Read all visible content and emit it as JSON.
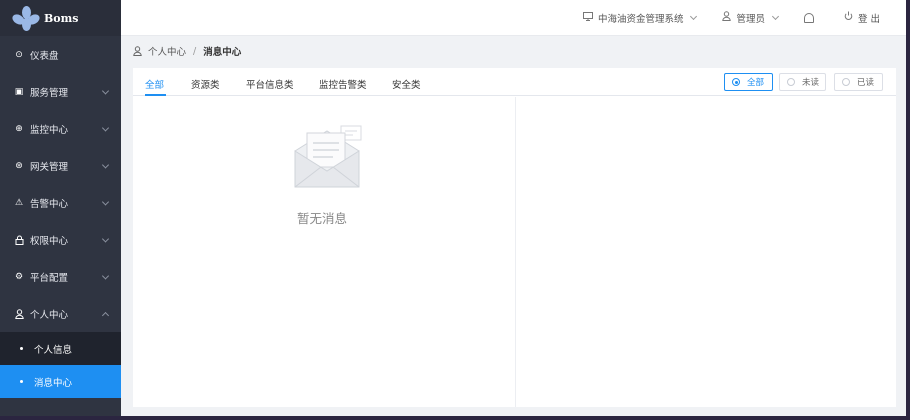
{
  "app": {
    "logo_text": "Boms"
  },
  "sidebar": {
    "items": [
      {
        "label": "仪表盘",
        "icon": "dashboard-icon",
        "glyph": "⊙",
        "has_chevron": false
      },
      {
        "label": "服务管理",
        "icon": "service-icon",
        "glyph": "▣",
        "has_chevron": true
      },
      {
        "label": "监控中心",
        "icon": "globe-icon",
        "glyph": "⊕",
        "has_chevron": true
      },
      {
        "label": "网关管理",
        "icon": "gateway-icon",
        "glyph": "⊛",
        "has_chevron": true
      },
      {
        "label": "告警中心",
        "icon": "warning-icon",
        "glyph": "⚠",
        "has_chevron": true
      },
      {
        "label": "权限中心",
        "icon": "lock-icon",
        "glyph": "🔒",
        "has_chevron": true
      },
      {
        "label": "平台配置",
        "icon": "settings-icon",
        "glyph": "⚙",
        "has_chevron": true
      },
      {
        "label": "个人中心",
        "icon": "user-icon",
        "glyph": "♙",
        "has_chevron": true,
        "expanded": true
      }
    ],
    "sub_items": [
      {
        "label": "个人信息",
        "active": false
      },
      {
        "label": "消息中心",
        "active": true
      }
    ]
  },
  "header": {
    "system_name": "中海油资金管理系统",
    "user_name": "管理员",
    "logout_label": "登 出"
  },
  "breadcrumb": {
    "parent": "个人中心",
    "separator": "/",
    "current": "消息中心"
  },
  "tabs": [
    {
      "label": "全部",
      "active": true
    },
    {
      "label": "资源类",
      "active": false
    },
    {
      "label": "平台信息类",
      "active": false
    },
    {
      "label": "监控告警类",
      "active": false
    },
    {
      "label": "安全类",
      "active": false
    }
  ],
  "filter": {
    "options": [
      {
        "label": "全部",
        "selected": true
      },
      {
        "label": "未读",
        "selected": false
      },
      {
        "label": "已读",
        "selected": false
      }
    ]
  },
  "empty_state": {
    "text": "暂无消息"
  },
  "colors": {
    "accent": "#1e8ff2",
    "sidebar_bg": "#2f3441",
    "submenu_bg": "#1f232d"
  }
}
